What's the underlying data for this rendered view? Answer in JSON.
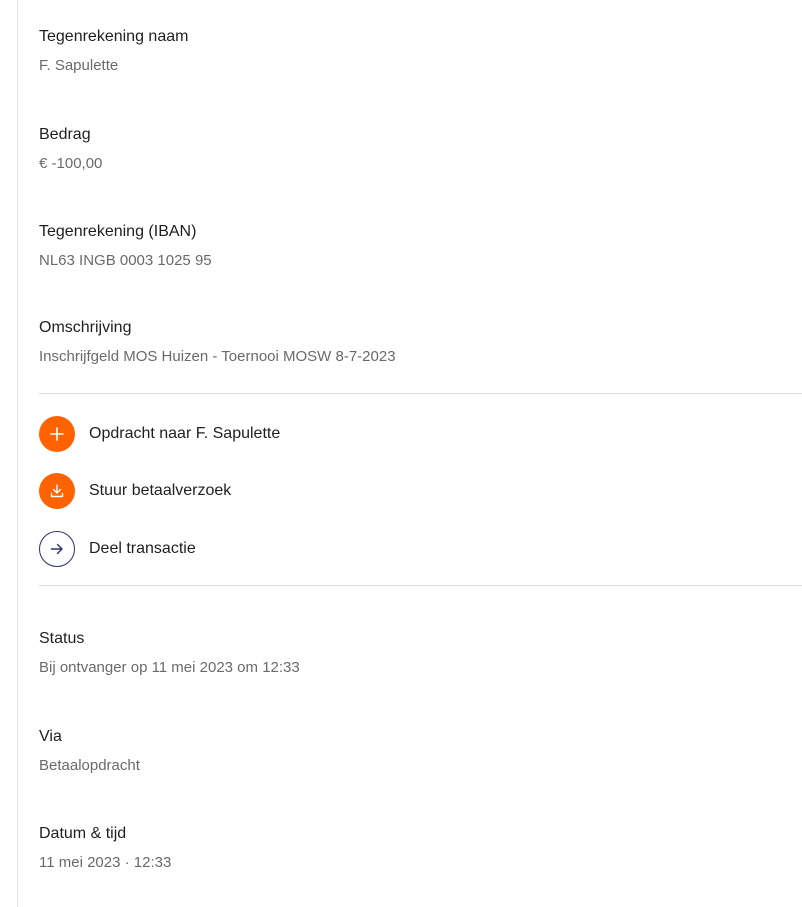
{
  "details": {
    "counterparty_name": {
      "label": "Tegenrekening naam",
      "value": "F. Sapulette"
    },
    "amount": {
      "label": "Bedrag",
      "value": "€ -100,00"
    },
    "counterparty_iban": {
      "label": "Tegenrekening (IBAN)",
      "value": "NL63 INGB 0003 1025 95"
    },
    "description": {
      "label": "Omschrijving",
      "value": "Inschrijfgeld MOS Huizen - Toernooi MOSW 8-7-2023"
    }
  },
  "actions": {
    "new_payment": {
      "label": "Opdracht naar F. Sapulette",
      "icon": "plus-icon",
      "color": "#ff6200"
    },
    "payment_request": {
      "label": "Stuur betaalverzoek",
      "icon": "download-icon",
      "color": "#ff6200"
    },
    "share": {
      "label": "Deel transactie",
      "icon": "arrow-right-icon",
      "color": "#2b2f6b"
    }
  },
  "meta": {
    "status": {
      "label": "Status",
      "value": "Bij ontvanger op 11 mei 2023 om 12:33"
    },
    "via": {
      "label": "Via",
      "value": "Betaalopdracht"
    },
    "datetime": {
      "label": "Datum & tijd",
      "value": "11 mei 2023 · 12:33"
    }
  }
}
